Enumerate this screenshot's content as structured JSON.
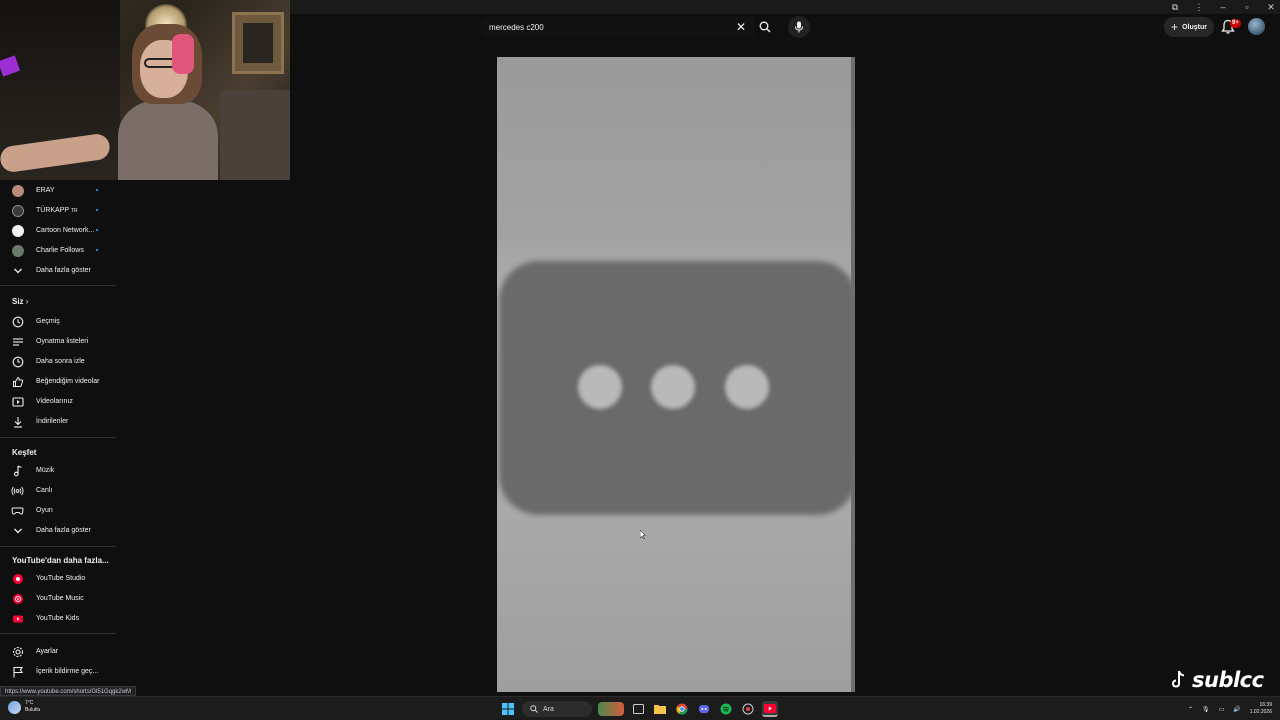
{
  "search": {
    "value": "mercedes c200"
  },
  "header": {
    "create_label": "Oluştur",
    "notification_badge": "9+"
  },
  "sidebar": {
    "channels": [
      {
        "label": "ERAY",
        "avatar_color": "#b98a7a"
      },
      {
        "label": "TÜRKAPP",
        "suffix": "TR",
        "avatar_color": "#3a3a3a"
      },
      {
        "label": "Cartoon Network...",
        "avatar_color": "#f1f1f1"
      },
      {
        "label": "Charlie Follows",
        "avatar_color": "#6b7b6a"
      }
    ],
    "show_more_1": "Daha fazla göster",
    "you_section": "Siz",
    "you_items": [
      {
        "label": "Geçmiş",
        "icon": "history-icon"
      },
      {
        "label": "Oynatma listeleri",
        "icon": "playlist-icon"
      },
      {
        "label": "Daha sonra izle",
        "icon": "watch-later-icon"
      },
      {
        "label": "Beğendiğim videolar",
        "icon": "like-icon"
      },
      {
        "label": "Videolarınız",
        "icon": "your-videos-icon"
      },
      {
        "label": "İndirilenler",
        "icon": "download-icon"
      }
    ],
    "explore_section": "Keşfet",
    "explore_items": [
      {
        "label": "Müzik",
        "icon": "music-icon"
      },
      {
        "label": "Canlı",
        "icon": "live-icon"
      },
      {
        "label": "Oyun",
        "icon": "gaming-icon"
      }
    ],
    "show_more_2": "Daha fazla göster",
    "more_section": "YouTube'dan daha fazla...",
    "more_items": [
      {
        "label": "YouTube Studio",
        "icon": "youtube-studio-icon"
      },
      {
        "label": "YouTube Music",
        "icon": "youtube-music-icon"
      },
      {
        "label": "YouTube Kids",
        "icon": "youtube-kids-icon"
      }
    ],
    "settings_items": [
      {
        "label": "Ayarlar",
        "icon": "settings-gear-icon"
      },
      {
        "label": "İçerik bildirme geç...",
        "icon": "flag-icon"
      }
    ]
  },
  "status_url": "https://www.youtube.com/shorts/Gl51Gqgk2wM",
  "watermark": "sublcc",
  "taskbar": {
    "weather_temp": "7°C",
    "weather_desc": "Bulutlu",
    "search_label": "Ara",
    "time": "16:39",
    "date": "1.02.2026"
  },
  "colors": {
    "background": "#0f0f0f",
    "accent_red": "#ff0033",
    "badge_red": "#cc0000"
  }
}
